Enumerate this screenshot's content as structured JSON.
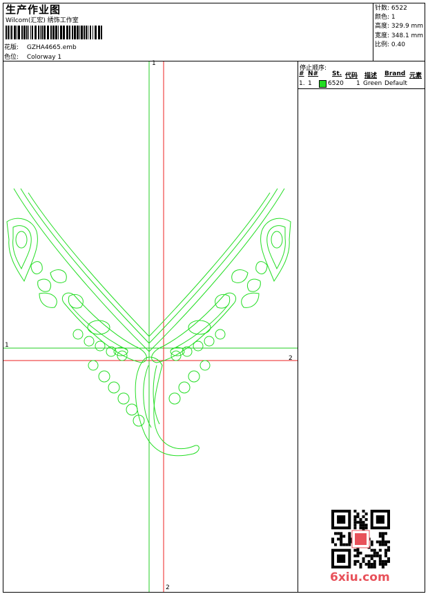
{
  "header": {
    "title": "生产作业图",
    "subtitle": "Wilcom(汇宏) 绣饰工作室",
    "design_label": "花版:",
    "design_value": "GZHA4665.emb",
    "colorway_label": "色位:",
    "colorway_value": "Colorway 1"
  },
  "stats": [
    {
      "label": "针数:",
      "value": "6522"
    },
    {
      "label": "颜色:",
      "value": "1"
    },
    {
      "label": "高度:",
      "value": "329.9 mm"
    },
    {
      "label": "宽度:",
      "value": "348.1 mm"
    },
    {
      "label": "比例:",
      "value": "0.40"
    }
  ],
  "stop_sequence": {
    "title": "停止顺序:",
    "columns": [
      "#",
      "N#",
      "St.",
      "代码",
      "描述",
      "Brand",
      "元素"
    ],
    "rows": [
      {
        "index": "1.",
        "needle": "1",
        "color": "#22dd22",
        "stitches": "6520",
        "code": "1",
        "desc": "Green",
        "brand": "Default"
      }
    ]
  },
  "axes": {
    "v_green_top": "1",
    "h_green_left": "1",
    "h_red_right": "2",
    "v_red_bottom": "2"
  },
  "colors": {
    "thread": "#22dd22",
    "axis_green": "#22cc22",
    "axis_red": "#ee2222"
  },
  "watermark": "6xiu.com"
}
